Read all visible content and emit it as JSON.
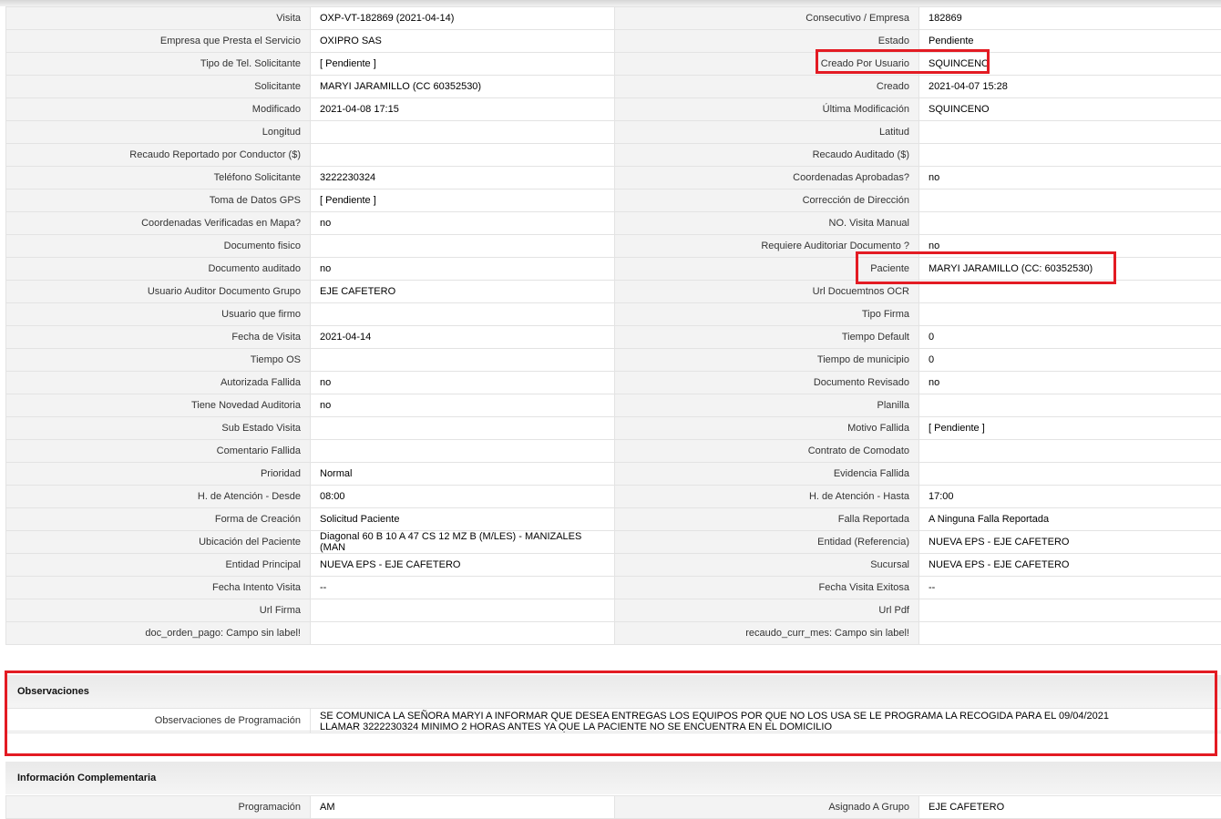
{
  "rows": [
    {
      "l1": "Visita",
      "v1": "OXP-VT-182869 (2021-04-14)",
      "l2": "Consecutivo / Empresa",
      "v2": "182869"
    },
    {
      "l1": "Empresa que Presta el Servicio",
      "v1": "OXIPRO SAS",
      "l2": "Estado",
      "v2": "Pendiente"
    },
    {
      "l1": "Tipo de Tel. Solicitante",
      "v1": "[ Pendiente ]",
      "l2": "Creado Por Usuario",
      "v2": "SQUINCENO"
    },
    {
      "l1": "Solicitante",
      "v1": "MARYI JARAMILLO (CC 60352530)",
      "l2": "Creado",
      "v2": "2021-04-07 15:28"
    },
    {
      "l1": "Modificado",
      "v1": "2021-04-08 17:15",
      "l2": "Última Modificación",
      "v2": " SQUINCENO"
    },
    {
      "l1": "Longitud",
      "v1": "",
      "l2": "Latitud",
      "v2": ""
    },
    {
      "l1": "Recaudo Reportado por Conductor ($)",
      "v1": "",
      "l2": "Recaudo Auditado ($)",
      "v2": ""
    },
    {
      "l1": "Teléfono Solicitante",
      "v1": "3222230324",
      "l2": "Coordenadas Aprobadas?",
      "v2": " no"
    },
    {
      "l1": "Toma de Datos GPS",
      "v1": "[ Pendiente ]",
      "l2": "Corrección de Dirección",
      "v2": ""
    },
    {
      "l1": "Coordenadas Verificadas en Mapa?",
      "v1": " no",
      "l2": "NO. Visita Manual",
      "v2": ""
    },
    {
      "l1": "Documento fisico",
      "v1": "",
      "l2": "Requiere Auditoriar Documento ?",
      "v2": " no"
    },
    {
      "l1": "Documento auditado",
      "v1": " no",
      "l2": "Paciente",
      "v2": "MARYI JARAMILLO (CC: 60352530)"
    },
    {
      "l1": "Usuario Auditor Documento Grupo",
      "v1": "EJE CAFETERO",
      "l2": "Url Docuemtnos OCR",
      "v2": ""
    },
    {
      "l1": "Usuario que firmo",
      "v1": "",
      "l2": "Tipo Firma",
      "v2": ""
    },
    {
      "l1": "Fecha de Visita",
      "v1": " 2021-04-14",
      "l2": "Tiempo Default",
      "v2": "0"
    },
    {
      "l1": "Tiempo OS",
      "v1": "",
      "l2": "Tiempo de municipio",
      "v2": "0"
    },
    {
      "l1": "Autorizada Fallida",
      "v1": " no",
      "l2": "Documento Revisado",
      "v2": " no"
    },
    {
      "l1": "Tiene Novedad Auditoria",
      "v1": " no",
      "l2": "Planilla",
      "v2": ""
    },
    {
      "l1": "Sub Estado Visita",
      "v1": "",
      "l2": "Motivo Fallida",
      "v2": "[ Pendiente ]"
    },
    {
      "l1": "Comentario Fallida",
      "v1": "",
      "l2": "Contrato de Comodato",
      "v2": ""
    },
    {
      "l1": "Prioridad",
      "v1": "Normal",
      "l2": "Evidencia Fallida",
      "v2": ""
    },
    {
      "l1": "H. de Atención - Desde",
      "v1": "08:00",
      "l2": "H. de Atención - Hasta",
      "v2": "17:00"
    },
    {
      "l1": "Forma de Creación",
      "v1": "Solicitud Paciente",
      "l2": "Falla Reportada",
      "v2": "A Ninguna Falla Reportada"
    },
    {
      "l1": "Ubicación del Paciente",
      "v1": "Diagonal 60 B 10 A 47 CS 12 MZ B (M/LES) - MANIZALES (MAN",
      "l2": "Entidad (Referencia)",
      "v2": "NUEVA EPS - EJE CAFETERO"
    },
    {
      "l1": "Entidad Principal",
      "v1": "NUEVA EPS - EJE CAFETERO",
      "l2": "Sucursal",
      "v2": "NUEVA EPS - EJE CAFETERO"
    },
    {
      "l1": "Fecha Intento Visita",
      "v1": "--",
      "l2": "Fecha Visita Exitosa",
      "v2": "--"
    },
    {
      "l1": "Url Firma",
      "v1": "",
      "l2": "Url Pdf",
      "v2": ""
    },
    {
      "l1": "doc_orden_pago: Campo sin label!",
      "v1": "",
      "l2": "recaudo_curr_mes: Campo sin label!",
      "v2": ""
    }
  ],
  "observaciones": {
    "title": "Observaciones",
    "label": "Observaciones de Programación",
    "text": " SE COMUNICA LA SEÑORA MARYI A INFORMAR QUE DESEA ENTREGAS LOS EQUIPOS POR QUE NO LOS USA SE LE PROGRAMA LA RECOGIDA PARA EL 09/04/2021\nLLAMAR 3222230324 MINIMO 2 HORAS ANTES YA QUE LA PACIENTE NO SE ENCUENTRA EN EL DOMICILIO"
  },
  "complementaria": {
    "title": "Información Complementaria",
    "l1": "Programación",
    "v1": "AM",
    "l2": "Asignado A Grupo",
    "v2": "EJE CAFETERO"
  },
  "colors": {
    "highlight": "#e31b23",
    "label_bg": "#f3f3f3",
    "border": "#e3e3e3"
  }
}
